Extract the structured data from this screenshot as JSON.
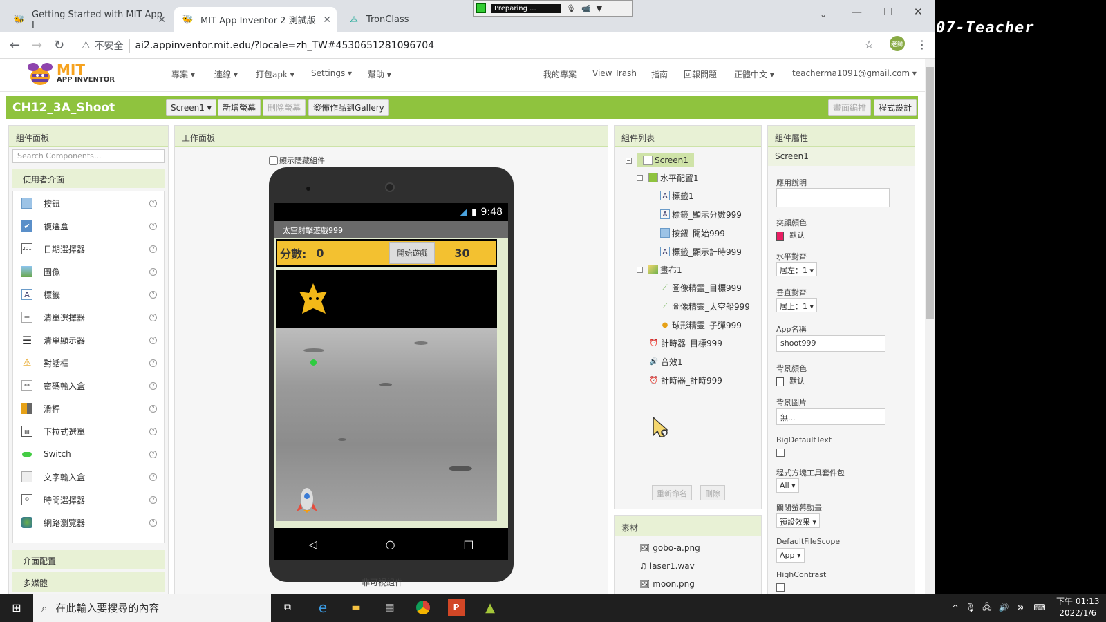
{
  "browser": {
    "tabs": [
      {
        "title": "Getting Started with MIT App I"
      },
      {
        "title": "MIT App Inventor 2 測試版"
      },
      {
        "title": "TronClass"
      }
    ],
    "recorder_status": "Preparing ...",
    "insecure_label": "不安全",
    "url": "ai2.appinventor.mit.edu/?locale=zh_TW#4530651281096704",
    "avatar_text": "老師"
  },
  "side_text": "07-Teacher",
  "app": {
    "logo_mit": "MIT",
    "logo_sub": "APP INVENTOR",
    "menu_left": [
      "專案",
      "連線",
      "打包apk",
      "Settings",
      "幫助"
    ],
    "menu_right": [
      "我的專案",
      "View Trash",
      "指南",
      "回報問題",
      "正體中文",
      "teacherma1091@gmail.com"
    ],
    "project_name": "CH12_3A_Shoot",
    "screen_dropdown": "Screen1",
    "add_screen": "新增螢幕",
    "remove_screen": "刪除螢幕",
    "publish": "發佈作品到Gallery",
    "designer": "畫面編排",
    "blocks": "程式設計"
  },
  "palette": {
    "title": "組件面板",
    "search_placeholder": "Search Components...",
    "section_ui": "使用者介面",
    "items": [
      "按鈕",
      "複選盒",
      "日期選擇器",
      "圖像",
      "標籤",
      "清單選擇器",
      "清單顯示器",
      "對話框",
      "密碼輸入盒",
      "滑桿",
      "下拉式選單",
      "Switch",
      "文字輸入盒",
      "時間選擇器",
      "網路瀏覽器"
    ],
    "section_layout": "介面配置",
    "section_media": "多媒體"
  },
  "viewer": {
    "title": "工作面板",
    "show_hidden": "顯示隱藏組件",
    "time": "9:48",
    "app_title": "太空射擊遊戲999",
    "score_label": "分數:",
    "score_value": "0",
    "start_button": "開始遊戲",
    "timer_value": "30",
    "non_visible": "非可視組件"
  },
  "components": {
    "title": "組件列表",
    "screen": "Screen1",
    "h_arrangement": "水平配置1",
    "label1": "標籤1",
    "label_score": "標籤_顯示分數999",
    "button_start": "按鈕_開始999",
    "label_timer": "標籤_顯示計時999",
    "canvas": "畫布1",
    "sprite_target": "圖像精靈_目標999",
    "sprite_ship": "圖像精靈_太空船999",
    "ball_bullet": "球形精靈_子彈999",
    "clock_target": "計時器_目標999",
    "sound": "音效1",
    "clock_timer": "計時器_計時999",
    "rename": "重新命名",
    "delete": "刪除"
  },
  "media": {
    "title": "素材",
    "files": [
      "gobo-a.png",
      "laser1.wav",
      "moon.png"
    ]
  },
  "properties": {
    "title": "組件屬性",
    "component": "Screen1",
    "about_label": "應用說明",
    "accent_label": "突顯顏色",
    "accent_value": "默认",
    "accent_color": "#e91e63",
    "align_h_label": "水平對齊",
    "align_h_value": "居左：1",
    "align_v_label": "垂直對齊",
    "align_v_value": "居上：1",
    "appname_label": "App名稱",
    "appname_value": "shoot999",
    "bgcolor_label": "背景顏色",
    "bgcolor_value": "默认",
    "bgimage_label": "背景圖片",
    "bgimage_value": "無...",
    "bigtext_label": "BigDefaultText",
    "toolkit_label": "程式方塊工具套件包",
    "toolkit_value": "All",
    "anim_label": "關閉螢幕動畫",
    "anim_value": "預設效果",
    "filescope_label": "DefaultFileScope",
    "filescope_value": "App",
    "contrast_label": "HighContrast"
  },
  "taskbar": {
    "search_placeholder": "在此輸入要搜尋的內容",
    "time": "下午 01:13",
    "date": "2022/1/6"
  }
}
